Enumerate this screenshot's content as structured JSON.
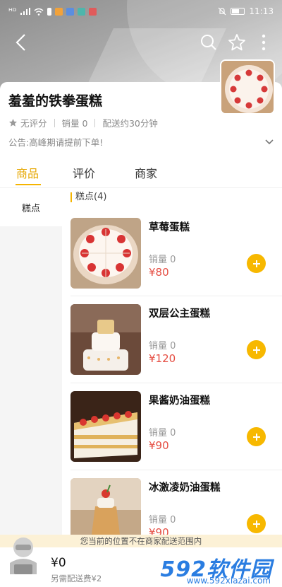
{
  "status_bar": {
    "signal": "ᴴᴰ",
    "time": "11:13",
    "app_chip_colors": [
      "#f2a23a",
      "#5b8ee0",
      "#4db6ac",
      "#e05b5b"
    ]
  },
  "nav": {
    "back_icon": "chevron-left-icon",
    "search_icon": "search-icon",
    "favorite_icon": "star-outline-icon",
    "more_icon": "more-vertical-icon"
  },
  "shop": {
    "name": "羞羞的铁拳蛋糕",
    "rating": "无评分",
    "sales": "销量 0",
    "delivery": "配送约30分钟",
    "notice": "公告:高峰期请提前下单!"
  },
  "tabs": [
    {
      "label": "商品",
      "active": true
    },
    {
      "label": "评价",
      "active": false
    },
    {
      "label": "商家",
      "active": false
    }
  ],
  "sidebar": {
    "items": [
      {
        "label": "糕点",
        "active": true
      }
    ]
  },
  "section": {
    "title": "糕点(4)"
  },
  "products": [
    {
      "name": "草莓蛋糕",
      "sales": "销量 0",
      "price": "¥80"
    },
    {
      "name": "双层公主蛋糕",
      "sales": "销量 0",
      "price": "¥120"
    },
    {
      "name": "果酱奶油蛋糕",
      "sales": "销量 0",
      "price": "¥90"
    },
    {
      "name": "冰激凌奶油蛋糕",
      "sales": "销量 0",
      "price": "¥90"
    }
  ],
  "cart": {
    "notice": "您当前的位置不在商家配送范围内",
    "total": "¥0",
    "extra_fee": "另需配送费¥2"
  },
  "watermark": {
    "title": "592软件园",
    "url": "www.592xiazai.com"
  },
  "colors": {
    "accent": "#f5b400",
    "price": "#e54d42"
  }
}
